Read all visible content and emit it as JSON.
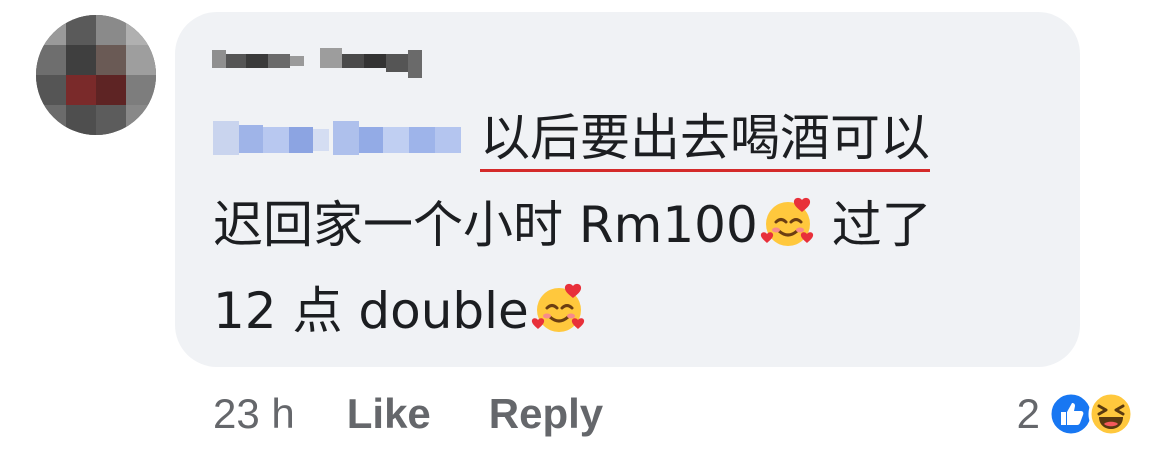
{
  "comment": {
    "text_line1": "以后要出去喝酒可以",
    "text_line2": "迟回家一个小时 Rm100",
    "text_line3": "12 点 double"
  },
  "meta": {
    "time": "23 h",
    "like_label": "Like",
    "reply_label": "Reply",
    "reaction_count": "2"
  },
  "icons": {
    "emoji": "smiling-face-with-hearts",
    "reactions": [
      "like-icon",
      "haha-icon"
    ]
  },
  "colors": {
    "bubble": "#f0f2f5",
    "text": "#1c1e21",
    "meta": "#65676b",
    "underline": "#d42a2a",
    "like_blue": "#1877f2"
  }
}
